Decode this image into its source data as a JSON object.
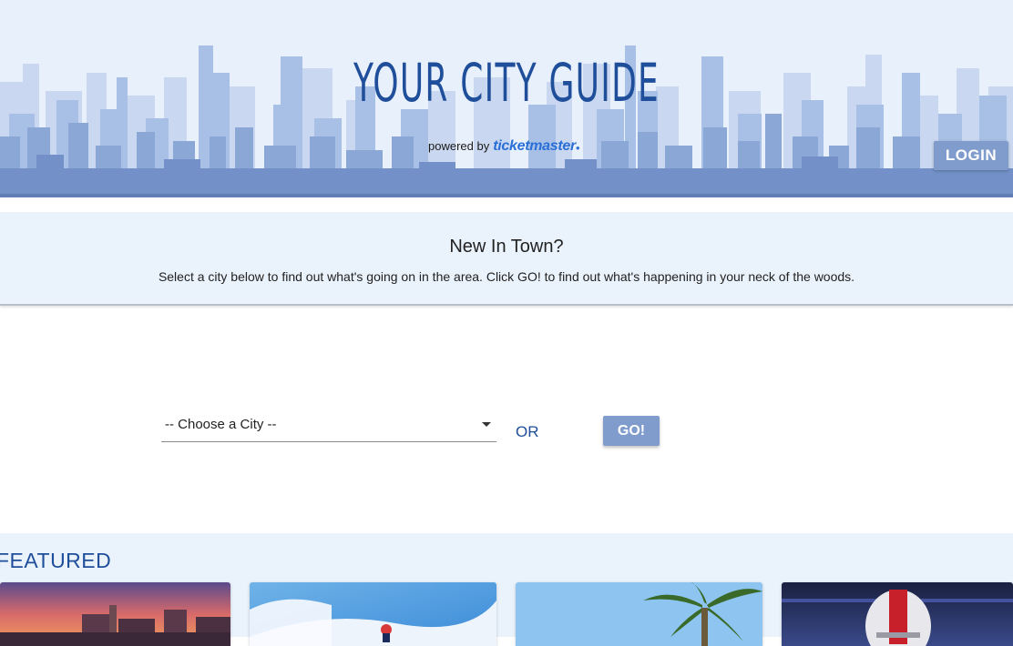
{
  "header": {
    "title": "YOUR CITY GUIDE",
    "powered_by": "powered by",
    "brand": "ticketmaster",
    "login_label": "LOGIN"
  },
  "intro": {
    "title": "New In Town?",
    "description": "Select a city below to find out what's going on in the area. Click GO! to find out what's happening in your neck of the woods."
  },
  "search": {
    "city_select_value": "-- Choose a City --",
    "or_label": "OR",
    "go_label": "GO!"
  },
  "featured": {
    "title": "FEATURED",
    "cards": [
      {
        "icon": "las-vegas-skyline-image"
      },
      {
        "icon": "snowboarder-image"
      },
      {
        "icon": "palm-tree-image"
      },
      {
        "icon": "football-player-image"
      }
    ]
  },
  "colors": {
    "accent": "#1f4e9a",
    "button": "#7f9ccd",
    "panel": "#eaf2fc",
    "header_bg": "#e8f0fb"
  }
}
